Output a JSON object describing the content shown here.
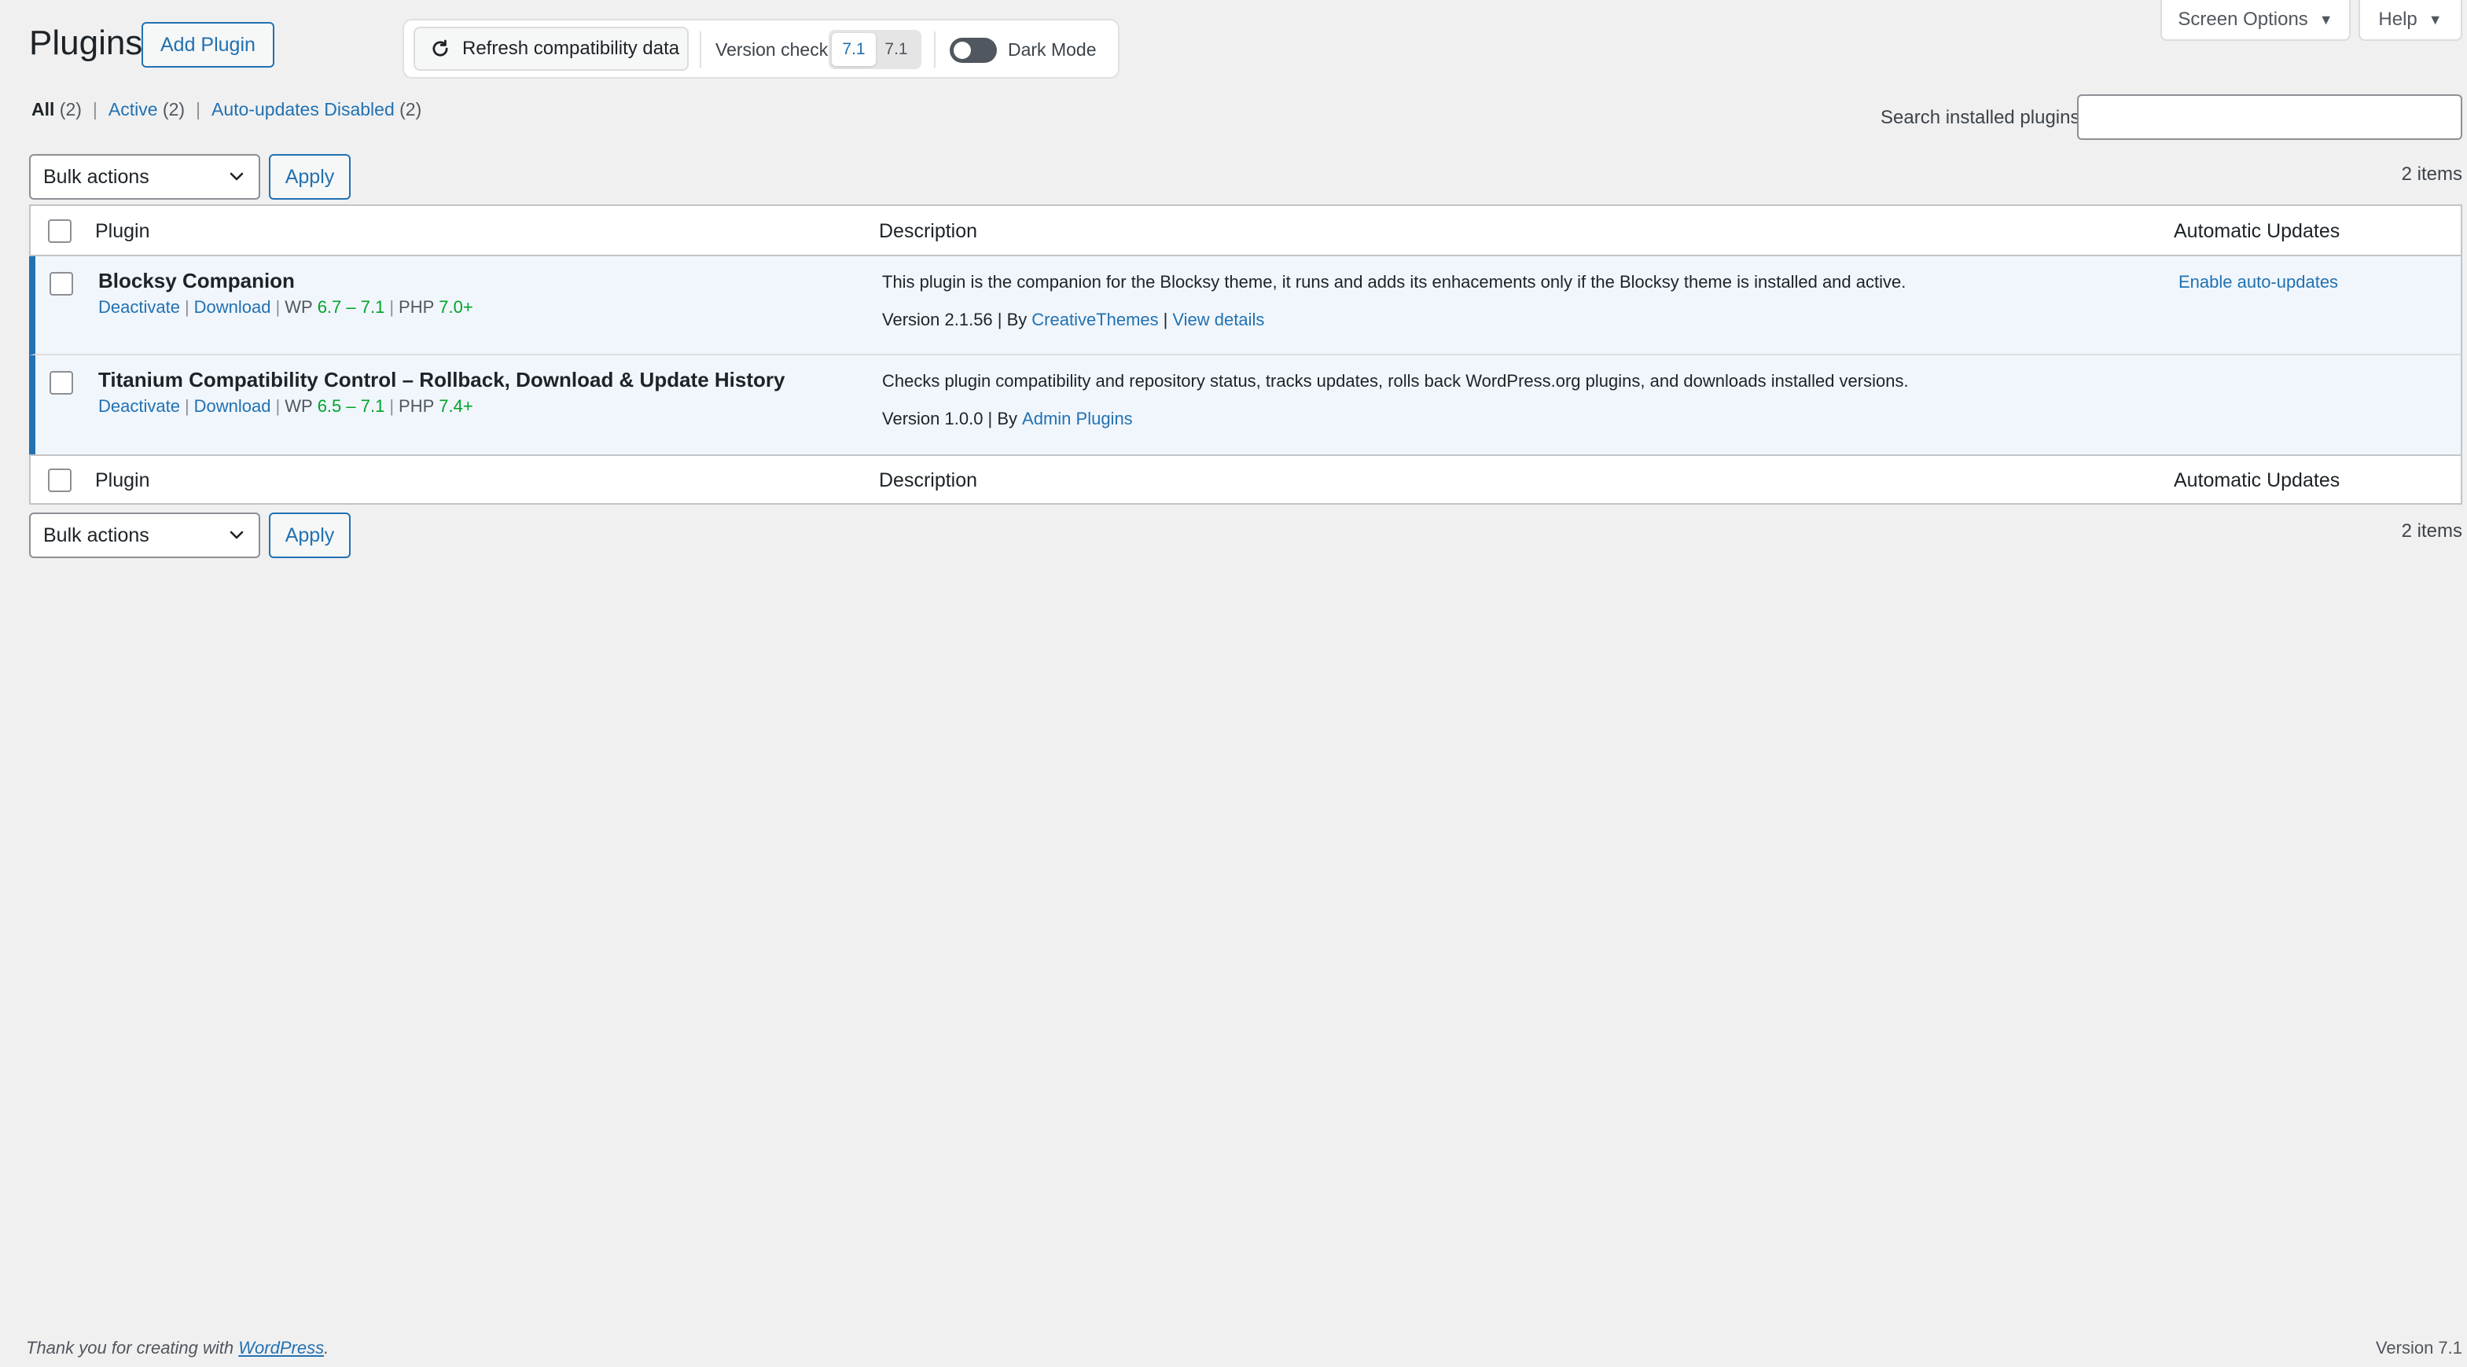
{
  "header": {
    "title": "Plugins",
    "add_plugin": "Add Plugin",
    "refresh": "Refresh compatibility data",
    "version_check_label": "Version check",
    "version_options": [
      "7.1",
      "7.1"
    ],
    "dark_mode_label": "Dark Mode",
    "dark_mode_on": false,
    "screen_options": "Screen Options",
    "help": "Help"
  },
  "filters": {
    "all": "All",
    "all_count": "(2)",
    "active": "Active",
    "active_count": "(2)",
    "auto_disabled": "Auto-updates Disabled",
    "auto_disabled_count": "(2)"
  },
  "search": {
    "label": "Search installed plugins",
    "value": ""
  },
  "bulk": {
    "label": "Bulk actions",
    "apply": "Apply",
    "items": "2 items"
  },
  "columns": {
    "plugin": "Plugin",
    "description": "Description",
    "auto": "Automatic Updates"
  },
  "plugins": [
    {
      "name": "Blocksy Companion",
      "deactivate": "Deactivate",
      "download": "Download",
      "wp_label": "WP",
      "wp_range": "6.7 – 7.1",
      "php_label": "PHP",
      "php_req": "7.0+",
      "description": "This plugin is the companion for the Blocksy theme, it runs and adds its enhacements only if the Blocksy theme is installed and active.",
      "version": "Version 2.1.56 | By",
      "author": "CreativeThemes",
      "view_details": "View details",
      "auto_updates": "Enable auto-updates"
    },
    {
      "name": "Titanium Compatibility Control – Rollback, Download & Update History",
      "deactivate": "Deactivate",
      "download": "Download",
      "wp_label": "WP",
      "wp_range": "6.5 – 7.1",
      "php_label": "PHP",
      "php_req": "7.4+",
      "description": "Checks plugin compatibility and repository status, tracks updates, rolls back WordPress.org plugins, and downloads installed versions.",
      "version": "Version 1.0.0 | By",
      "author": "Admin Plugins"
    }
  ],
  "footer": {
    "thanks_prefix": "Thank you for creating with",
    "thanks_link": "WordPress",
    "thanks_suffix": ".",
    "version": "Version 7.1"
  },
  "colors": {
    "accent": "#2271b1",
    "ok": "#00a32a",
    "background": "#f0f0f1",
    "active_row": "#f0f6fc"
  }
}
